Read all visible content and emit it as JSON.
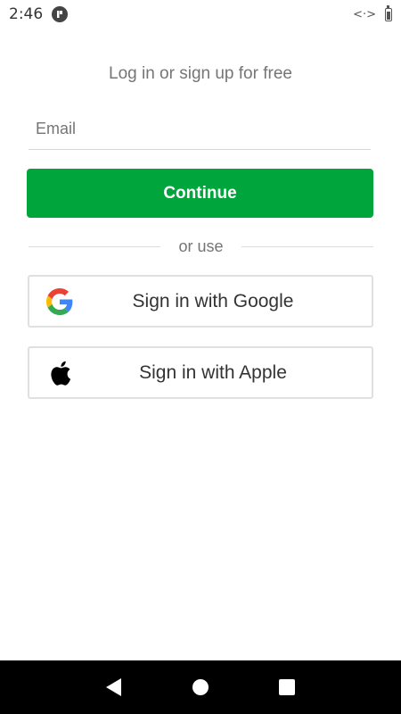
{
  "status_bar": {
    "time": "2:46",
    "data_indicator": "<·>"
  },
  "login": {
    "headline": "Log in or sign up for free",
    "email_placeholder": "Email",
    "continue_label": "Continue",
    "divider_text": "or use",
    "google_label": "Sign in with Google",
    "apple_label": "Sign in with Apple"
  },
  "colors": {
    "accent": "#00a63c",
    "google_blue": "#4285F4",
    "google_red": "#EA4335",
    "google_yellow": "#FBBC05",
    "google_green": "#34A853"
  },
  "icons": {
    "status_app": "app-notification-icon",
    "battery": "battery-icon",
    "google": "google-logo-icon",
    "apple": "apple-logo-icon",
    "nav_back": "back-triangle-icon",
    "nav_home": "home-circle-icon",
    "nav_recents": "recents-square-icon"
  }
}
